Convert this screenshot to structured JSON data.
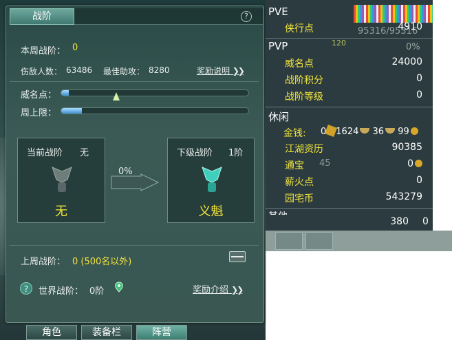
{
  "panel": {
    "tab_title": "战阶",
    "help_symbol": "?",
    "weekly_rank_label": "本周战阶：",
    "weekly_rank_value": "0",
    "kills_label": "伤敌人数：",
    "kills_value": "63486",
    "assist_label": "最佳助攻：",
    "assist_value": "8280",
    "reward_desc_link": "奖励说明",
    "fame_label": "威名点：",
    "fame_progress": 0.04,
    "weekly_cap_label": "周上限：",
    "weekly_cap_progress": 0.11,
    "current_rank_label": "当前战阶",
    "current_rank_value": "无",
    "current_rank_name": "无",
    "progress_percent": "0%",
    "next_rank_label": "下级战阶",
    "next_rank_value": "1阶",
    "next_rank_name": "义魁",
    "last_week_label": "上周战阶：",
    "last_week_value": "0 (500名以外)",
    "world_rank_label": "世界战阶：",
    "world_rank_value": "0阶",
    "reward_intro_link": "奖励介绍",
    "chevrons": "❯❯"
  },
  "bottom_tabs": [
    {
      "label": "角色"
    },
    {
      "label": "装备栏"
    },
    {
      "label": "阵营"
    }
  ],
  "stats": {
    "pve_header": "PVE",
    "xia_label": "侠行点",
    "xia_value": "4910",
    "bg_numbers": "95316/95316",
    "bg_number_120": "120",
    "pvp_header": "PVP",
    "pvp_percent": "0%",
    "fame_label": "威名点",
    "fame_value": "24000",
    "rank_points_label": "战阶积分",
    "rank_points_value": "0",
    "rank_level_label": "战阶等级",
    "rank_level_value": "0",
    "leisure_header": "休闲",
    "money_label": "金钱:",
    "money_gold": "0",
    "money_silver_a": "1624",
    "money_silver_b": "36",
    "money_copper": "99",
    "jianghu_label": "江湖资历",
    "jianghu_value": "90385",
    "tongbao_label": "通宝",
    "tongbao_value": "0",
    "tongbao_bg": "45",
    "firewood_label": "薪火点",
    "firewood_value": "0",
    "garden_label": "园宅币",
    "garden_value": "543279",
    "other_header_partial": "其他",
    "bottom_value_a": "380",
    "bottom_value_b": "0"
  },
  "colors": {
    "accent_yellow": "#f3e23b",
    "panel_bg": "#3b5a55",
    "progress_blue": "#3f8fcf"
  }
}
